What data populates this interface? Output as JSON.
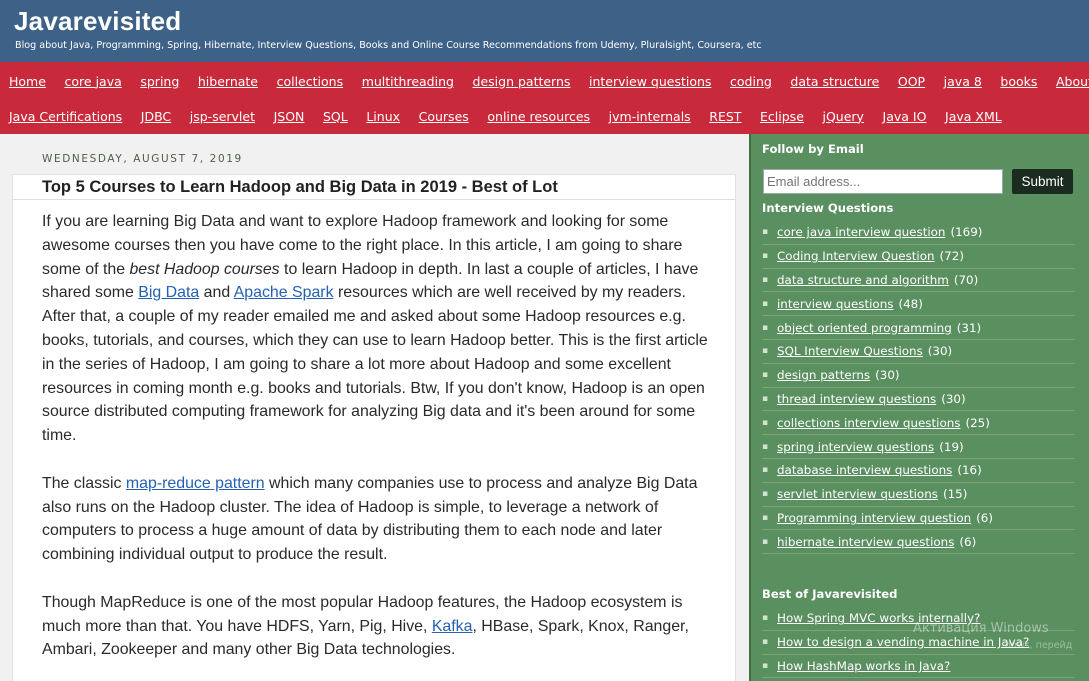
{
  "header": {
    "title": "Javarevisited",
    "description": "Blog about Java, Programming, Spring, Hibernate, Interview Questions, Books and Online Course Recommendations from Udemy, Pluralsight, Coursera, etc"
  },
  "nav": {
    "row1": [
      "Home",
      "core java",
      "spring",
      "hibernate",
      "collections",
      "multithreading",
      "design patterns",
      "interview questions",
      "coding",
      "data structure",
      "OOP",
      "java 8",
      "books",
      "About Me"
    ],
    "row2": [
      "Java Certifications",
      "JDBC",
      "jsp-servlet",
      "JSON",
      "SQL",
      "Linux",
      "Courses",
      "online resources",
      "jvm-internals",
      "REST",
      "Eclipse",
      "jQuery",
      "Java IO",
      "Java XML"
    ]
  },
  "post": {
    "date": "Wednesday, August 7, 2019",
    "title": "Top 5 Courses to Learn Hadoop and Big Data in 2019 - Best of Lot",
    "p1": {
      "t1": "If you are learning Big Data and want to explore Hadoop framework and looking for some awesome courses then you have come to the right place. In this article, I am going to share some of the ",
      "em": "best Hadoop courses",
      "t2": " to learn Hadoop in depth. In last a couple of articles, I have shared some ",
      "link1": "Big Data",
      "t3": " and ",
      "link2": "Apache Spark",
      "t4": " resources which are well received by my readers. After that, a couple of my reader emailed me and asked about some Hadoop resources e.g. books, tutorials, and courses, which they can use to learn Hadoop better. This is the first article in the series of Hadoop, I am going to share a lot more about Hadoop and some excellent resources in coming month e.g. books and tutorials. Btw, If you don't know, Hadoop is an open source distributed computing framework for analyzing Big data and it's been around for some time."
    },
    "p2": {
      "t1": "The classic ",
      "link1": "map-reduce pattern",
      "t2": " which many companies use to process and analyze Big Data also runs on the Hadoop cluster. The idea of Hadoop is simple, to leverage a network of computers to process a huge amount of data by distributing them to each node and later combining individual output to produce the result."
    },
    "p3": {
      "t1": "Though MapReduce is one of the most popular Hadoop features, the Hadoop ecosystem is much more than that. You have HDFS, Yarn, Pig, Hive, ",
      "link1": "Kafka",
      "t2": ", HBase, Spark, Knox, Ranger, Ambari, Zookeeper and many other Big Data technologies."
    }
  },
  "sidebar": {
    "follow_heading": "Follow by Email",
    "email_placeholder": "Email address...",
    "submit_label": "Submit",
    "interview_heading": "Interview Questions",
    "interview_items": [
      {
        "label": "core java interview question",
        "count": "(169)"
      },
      {
        "label": "Coding Interview Question",
        "count": "(72)"
      },
      {
        "label": "data structure and algorithm",
        "count": "(70)"
      },
      {
        "label": "interview questions",
        "count": "(48)"
      },
      {
        "label": "object oriented programming",
        "count": "(31)"
      },
      {
        "label": "SQL Interview Questions",
        "count": "(30)"
      },
      {
        "label": "design patterns",
        "count": "(30)"
      },
      {
        "label": "thread interview questions",
        "count": "(30)"
      },
      {
        "label": "collections interview questions",
        "count": "(25)"
      },
      {
        "label": "spring interview questions",
        "count": "(19)"
      },
      {
        "label": "database interview questions",
        "count": "(16)"
      },
      {
        "label": "servlet interview questions",
        "count": "(15)"
      },
      {
        "label": "Programming interview question",
        "count": "(6)"
      },
      {
        "label": "hibernate interview questions",
        "count": "(6)"
      }
    ],
    "best_heading": "Best of Javarevisited",
    "best_items": [
      {
        "label": "How Spring MVC works internally?"
      },
      {
        "label": "How to design a vending machine in Java?"
      },
      {
        "label": "How HashMap works in Java?"
      }
    ]
  },
  "watermark": {
    "line1": "Активация Windows",
    "line2": "dows, перейд"
  }
}
